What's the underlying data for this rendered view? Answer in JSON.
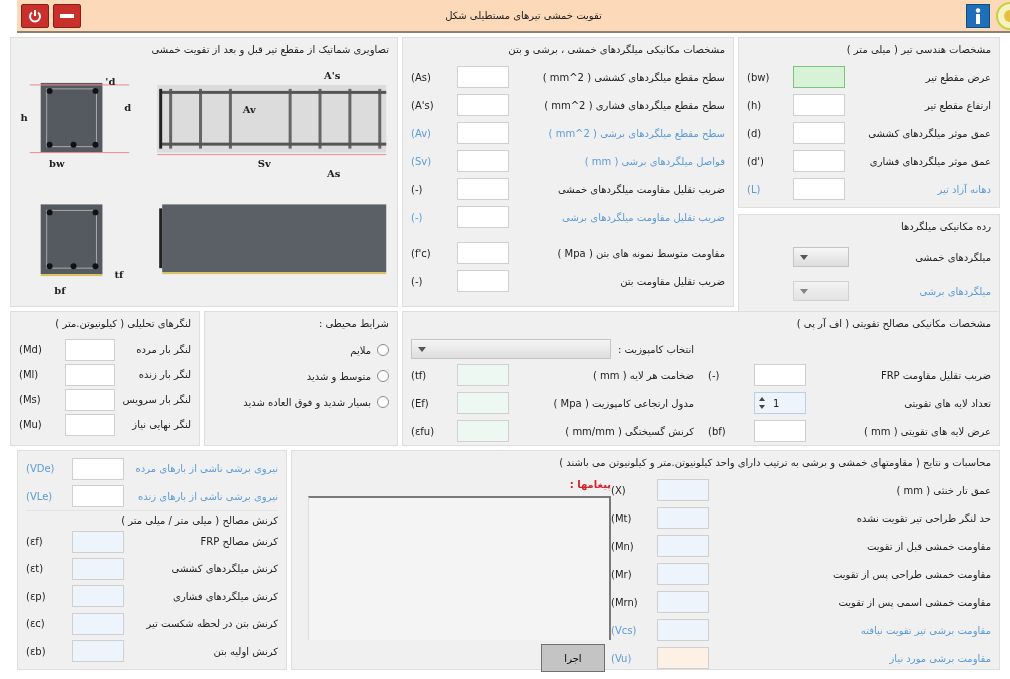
{
  "window": {
    "title": "تقویت خمشی تیرهای مستطیلی شکل"
  },
  "geometry": {
    "title": "مشخصات هندسی تیر ( میلی متر )",
    "fields": [
      {
        "label": "عرض مقطع تیر",
        "symbol": "(bw)",
        "disabled": false,
        "focused": true,
        "kind": "input"
      },
      {
        "label": "ارتفاع مقطع تیر",
        "symbol": "(h)",
        "disabled": false,
        "focused": false,
        "kind": "input"
      },
      {
        "label": "عمق موثر میلگردهای کششی",
        "symbol": "(d)",
        "disabled": false,
        "focused": false,
        "kind": "input"
      },
      {
        "label": "عمق موثر میلگردهای فشاری",
        "symbol": "(d')",
        "disabled": false,
        "focused": false,
        "kind": "input"
      },
      {
        "label": "دهانه آزاد تیر",
        "symbol": "(L)",
        "disabled": true,
        "focused": false,
        "kind": "input"
      }
    ]
  },
  "rebar_class": {
    "title": "رده مکانیکی میلگردها",
    "items": [
      {
        "label": "میلگردهای خمشی",
        "disabled": false
      },
      {
        "label": "میلگردهای برشی",
        "disabled": true
      }
    ]
  },
  "mechanical": {
    "title": "مشخصات مکانیکی میلگردهای خمشی ، برشی و بتن",
    "fields": [
      {
        "label": "سطح مقطع میلگردهای کششی ( mm^2 )",
        "symbol": "(As)",
        "disabled": false,
        "kind": "input"
      },
      {
        "label": "سطح مقطع میلگردهای فشاری ( mm^2 )",
        "symbol": "(A's)",
        "disabled": false,
        "kind": "input"
      },
      {
        "label": "سطح مقطع میلگردهای برشی ( mm^2 )",
        "symbol": "(Av)",
        "disabled": true,
        "kind": "input"
      },
      {
        "label": "فواصل میلگردهای برشی ( mm )",
        "symbol": "(Sv)",
        "disabled": true,
        "kind": "input"
      },
      {
        "label": "ضریب تقلیل مقاومت میلگردهای خمشی",
        "symbol": "(-)",
        "disabled": false,
        "kind": "input"
      },
      {
        "label": "ضریب تقلیل مقاومت میلگردهای برشی",
        "symbol": "(-)",
        "disabled": true,
        "kind": "input"
      },
      {
        "label": "مقاومت متوسط نمونه های بتن ( Mpa )",
        "symbol": "(f'c)",
        "disabled": false,
        "kind": "input"
      },
      {
        "label": "ضریب تقلیل مقاومت بتن",
        "symbol": "(-)",
        "disabled": false,
        "kind": "input"
      }
    ]
  },
  "schematic": {
    "title": "تصاویری شماتیک از مقطع تیر قبل و بعد از تقویت خمشی",
    "labels": [
      "d'",
      "h",
      "d",
      "bw",
      "A's",
      "Av",
      "Sv",
      "As",
      "tf",
      "bf"
    ]
  },
  "frp": {
    "title": "مشخصات مکانیکی مصالح تقویتی ( اف آر پی )",
    "composite_label": "انتخاب کامپوزیت :",
    "right_fields": [
      {
        "label": "ضریب تقلیل مقاومت FRP",
        "symbol": "(-)",
        "disabled": false,
        "kind": "input"
      },
      {
        "label": "تعداد لایه های تقویتی",
        "disabled": false,
        "kind": "spinner",
        "value": "1"
      },
      {
        "label": "عرض لایه های تقویتی ( mm )",
        "symbol": "(bf)",
        "disabled": false,
        "kind": "input"
      }
    ],
    "left_fields": [
      {
        "label": "ضخامت هر لایه ( mm )",
        "symbol": "(tf)",
        "disabled": false,
        "kind": "catalog"
      },
      {
        "label": "مدول ارتجاعی کامپوزیت ( Mpa )",
        "symbol": "(Ef)",
        "disabled": false,
        "kind": "catalog"
      },
      {
        "label": "کرنش گسیختگی ( mm/mm )",
        "symbol": "(εfu)",
        "disabled": false,
        "kind": "catalog"
      }
    ]
  },
  "environment": {
    "title": "شرایط محیطی :",
    "options": [
      {
        "label": "ملایم",
        "selected": false
      },
      {
        "label": "متوسط و شدید",
        "selected": false
      },
      {
        "label": "بسیار شدید و فوق العاده شدید",
        "selected": false
      }
    ]
  },
  "moments": {
    "title": "لنگرهای تحلیلی ( کیلونیوتن.متر )",
    "fields": [
      {
        "label": "لنگر بار مرده",
        "symbol": "(Md)",
        "disabled": false
      },
      {
        "label": "لنگر بار زنده",
        "symbol": "(Ml)",
        "disabled": false
      },
      {
        "label": "لنگر بار سرویس",
        "symbol": "(Ms)",
        "disabled": false
      },
      {
        "label": "لنگر نهایی نیاز",
        "symbol": "(Mu)",
        "disabled": false
      }
    ]
  },
  "results": {
    "title": "محاسبات و نتایج ( مقاومتهای خمشی و برشی به ترتیب دارای واحد کیلونیوتن.متر و کیلونیوتن می باشند )",
    "fields": [
      {
        "label": "عمق تار خنثی ( mm )",
        "symbol": "(X)",
        "disabled": false,
        "kind": "output"
      },
      {
        "label": "حد لنگر طراحی تیر تقویت نشده",
        "symbol": "(Mt)",
        "disabled": false,
        "kind": "output"
      },
      {
        "label": "مقاومت خمشی قبل از تقویت",
        "symbol": "(Mn)",
        "disabled": false,
        "kind": "output"
      },
      {
        "label": "مقاومت خمشی طراحی پس از تقویت",
        "symbol": "(Mr)",
        "disabled": false,
        "kind": "output"
      },
      {
        "label": "مقاومت خمشی اسمی پس از تقویت",
        "symbol": "(Mrn)",
        "disabled": false,
        "kind": "output"
      },
      {
        "label": "مقاومت برشی تیر تقویت نیافته",
        "symbol": "(Vcs)",
        "disabled": true,
        "kind": "output"
      },
      {
        "label": "مقاومت برشی مورد نیاز",
        "symbol": "(Vu)",
        "disabled": true,
        "kind": "required"
      }
    ],
    "messages_label": "پیغامها :",
    "run_button": "اجرا"
  },
  "shear": {
    "fields": [
      {
        "label": "نیروی برشی ناشی از بارهای مرده",
        "symbol": "(VDe)",
        "disabled": true,
        "kind": "input"
      },
      {
        "label": "نیروی برشی ناشی از بارهای زنده",
        "symbol": "(VLe)",
        "disabled": true,
        "kind": "input"
      }
    ]
  },
  "strains": {
    "title": "کرنش مصالح ( میلی متر / میلی متر )",
    "fields": [
      {
        "label": "کرنش مصالح FRP",
        "symbol": "(εf)",
        "disabled": false,
        "kind": "output"
      },
      {
        "label": "کرنش میلگردهای کششی",
        "symbol": "(εt)",
        "disabled": false,
        "kind": "output"
      },
      {
        "label": "کرنش میلگردهای فشاری",
        "symbol": "(εp)",
        "disabled": false,
        "kind": "output"
      },
      {
        "label": "کرنش بتن در لحظه شکست تیر",
        "symbol": "(εc)",
        "disabled": false,
        "kind": "output"
      },
      {
        "label": "کرنش اولیه بتن",
        "symbol": "(εb)",
        "disabled": false,
        "kind": "output"
      }
    ]
  }
}
